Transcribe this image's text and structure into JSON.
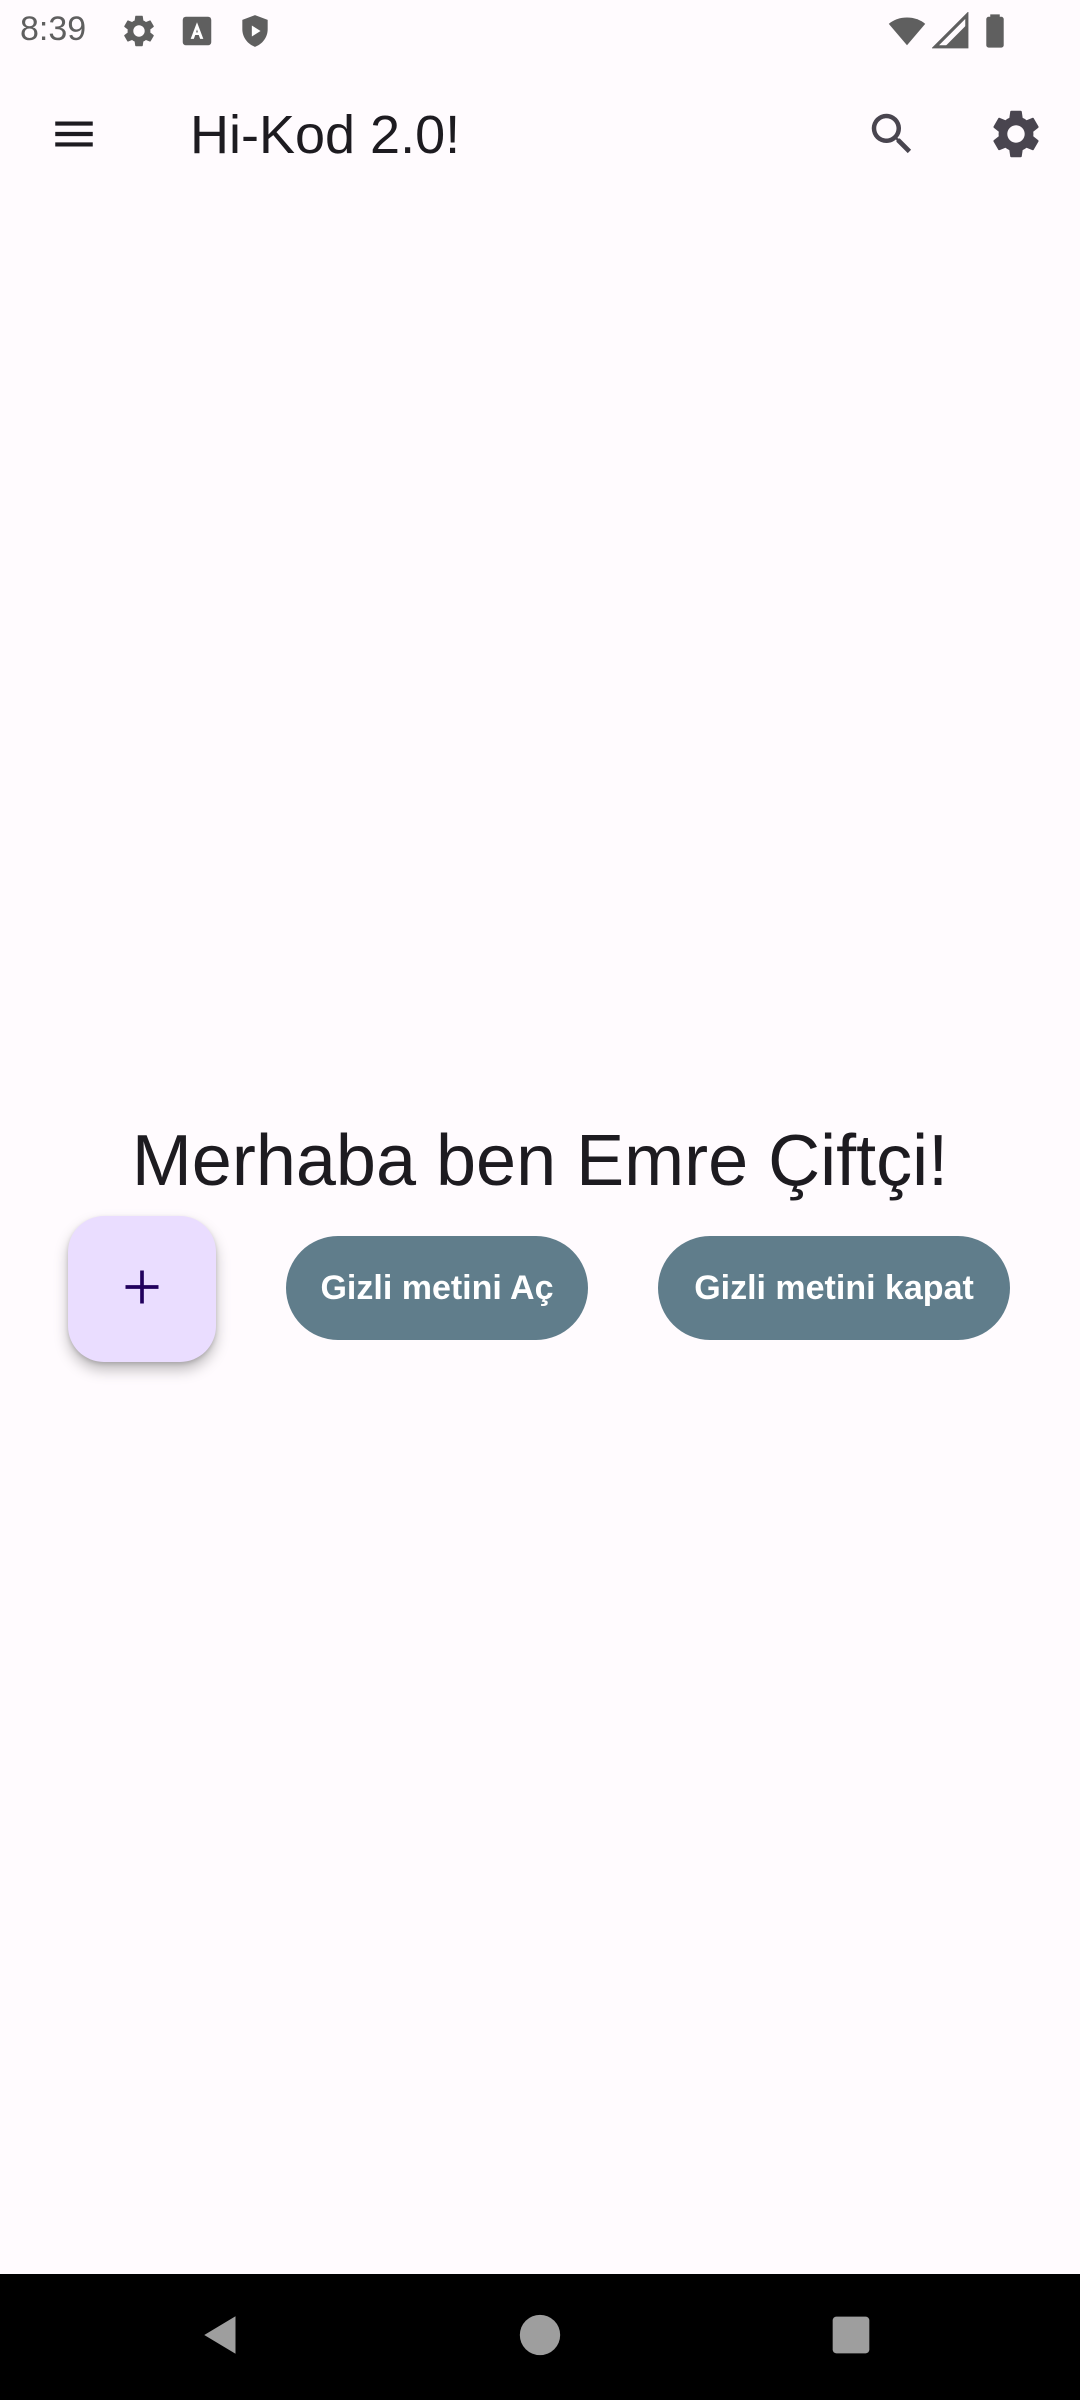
{
  "status_bar": {
    "time": "8:39",
    "left_icons": [
      "gear-icon",
      "text-a-icon",
      "shield-play-icon"
    ],
    "right_icons": [
      "wifi-icon",
      "signal-icon",
      "battery-icon"
    ]
  },
  "app_bar": {
    "title": "Hi-Kod 2.0!",
    "menu_icon": "hamburger-menu-icon",
    "search_icon": "search-icon",
    "settings_icon": "gear-icon"
  },
  "main": {
    "greeting": "Merhaba ben Emre Çiftçi!",
    "fab_icon": "plus-icon",
    "open_button_label": "Gizli metini Aç",
    "close_button_label": "Gizli metini kapat"
  },
  "colors": {
    "background": "#fffbfe",
    "fab_background": "#eaddff",
    "button_background": "#607d8b",
    "nav_bar": "#000000"
  },
  "nav_bar": {
    "items": [
      "back-icon",
      "home-icon",
      "recents-icon"
    ]
  }
}
